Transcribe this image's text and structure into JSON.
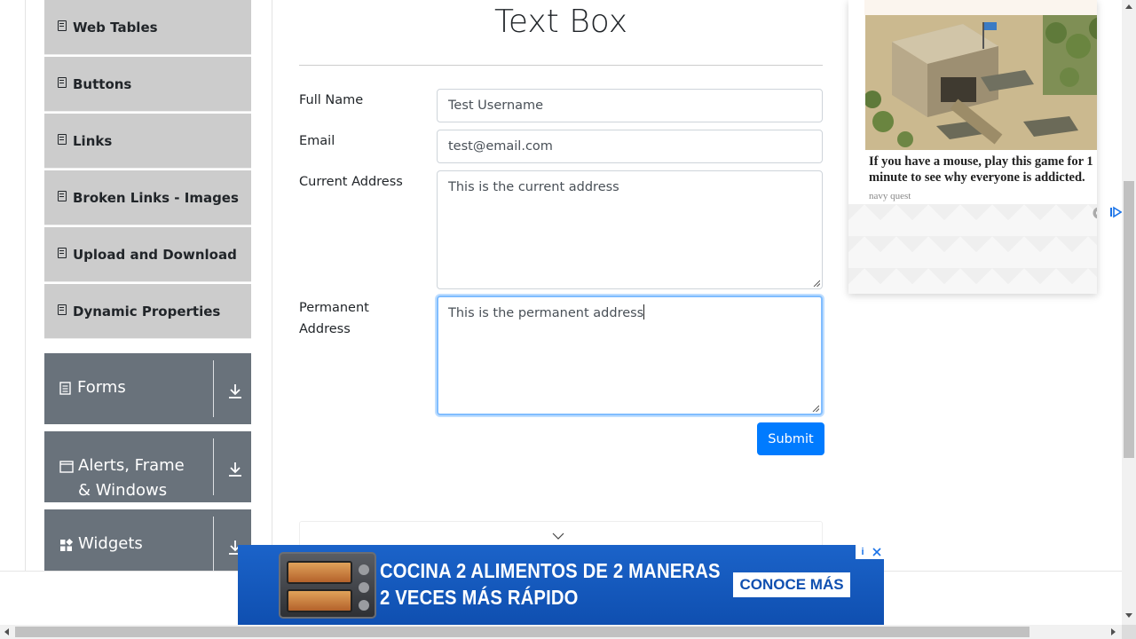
{
  "sidebar": {
    "items": [
      {
        "label": "Web Tables"
      },
      {
        "label": "Buttons"
      },
      {
        "label": "Links"
      },
      {
        "label": "Broken Links - Images"
      },
      {
        "label": "Upload and Download"
      },
      {
        "label": "Dynamic Properties"
      }
    ],
    "groups": [
      {
        "label": "Forms",
        "icon": "form-icon"
      },
      {
        "label": "Alerts, Frame & Windows",
        "icon": "window-icon"
      },
      {
        "label": "Widgets",
        "icon": "widgets-icon"
      }
    ]
  },
  "main": {
    "title": "Text Box",
    "fields": {
      "full_name": {
        "label": "Full Name",
        "value": "Test Username"
      },
      "email": {
        "label": "Email",
        "value": "test@email.com"
      },
      "current_address": {
        "label": "Current Address",
        "value": "This is the current address"
      },
      "permanent_address": {
        "label_line1": "Permanent",
        "label_line2": "Address",
        "value": "This is the permanent address"
      }
    },
    "submit_label": "Submit"
  },
  "ad_right": {
    "headline": "If you have a mouse, play this game for 1 minute to see why everyone is addicted.",
    "source": "navy quest"
  },
  "ad_bottom": {
    "line1": "COCINA 2 ALIMENTOS DE 2 MANERAS",
    "line2": "2 VECES MÁS RÁPIDO",
    "cta": "CONOCE MÁS",
    "info": "i",
    "accent": "#0f4fb0"
  },
  "colors": {
    "submit": "#007bff",
    "group_bg": "#69727b",
    "item_bg": "#cccccc"
  }
}
